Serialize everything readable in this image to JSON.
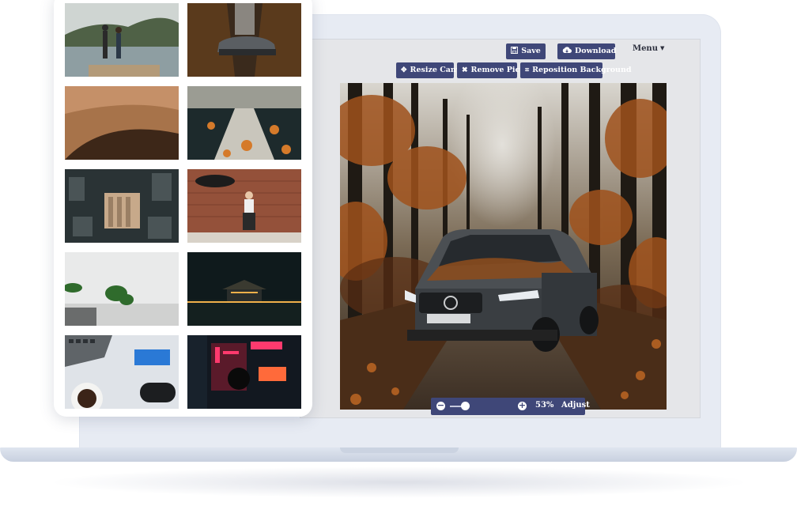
{
  "toolbar": {
    "save_label": "Save",
    "download_label": "Download",
    "menu_label": "Menu"
  },
  "canvas_tools": {
    "resize_label": "Resize Canvas",
    "remove_label": "Remove Picture",
    "reposition_label": "Reposition Background"
  },
  "zoom": {
    "percent_label": "53%",
    "percent": 53,
    "adjust_label": "Adjust"
  },
  "colors": {
    "button_bg": "#3f4778",
    "laptop_frame": "#e7ebf3",
    "screen_bg": "#e5e6e9"
  },
  "icons": {
    "save": "floppy-disk-icon",
    "download": "cloud-download-icon",
    "menu": "caret-down-icon",
    "resize": "arrows-move-icon",
    "remove": "x-icon",
    "reposition": "crop-icon",
    "zoom_out": "minus-circle-icon",
    "zoom_in": "plus-circle-icon"
  },
  "gallery": {
    "thumbnails": [
      "couple-on-dock",
      "car-forest-road",
      "sand-dune",
      "leaf-pathway",
      "aerial-city",
      "umbrella-woman-brick-wall",
      "plant-white-wall",
      "temple-night",
      "laptop-coffee-desk",
      "neon-signs-night"
    ]
  }
}
